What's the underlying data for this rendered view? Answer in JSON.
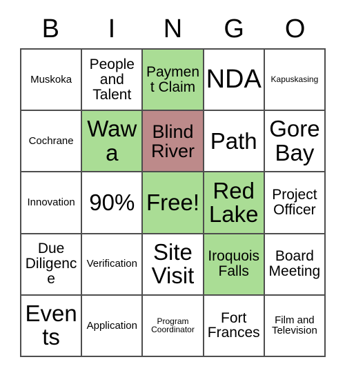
{
  "card": {
    "headers": [
      "B",
      "I",
      "N",
      "G",
      "O"
    ],
    "free_space_label": "Free!",
    "marked_color_green": "#aadd95",
    "marked_color_rose": "#bd8a8a",
    "grid_line_color": "#4d4d4d",
    "text_color": "#000000",
    "background_color": "#ffffff",
    "rows": [
      [
        {
          "label": "Muskoka",
          "size": "sm",
          "state": "unmarked"
        },
        {
          "label": "People and Talent",
          "size": "md",
          "state": "unmarked"
        },
        {
          "label": "Payment Claim",
          "size": "md",
          "state": "green"
        },
        {
          "label": "NDA",
          "size": "xxl",
          "state": "unmarked"
        },
        {
          "label": "Kapuskasing",
          "size": "xs",
          "state": "unmarked"
        }
      ],
      [
        {
          "label": "Cochrane",
          "size": "sm",
          "state": "unmarked"
        },
        {
          "label": "Wawa",
          "size": "xl",
          "state": "green"
        },
        {
          "label": "Blind River",
          "size": "lg",
          "state": "rose"
        },
        {
          "label": "Path",
          "size": "xl",
          "state": "unmarked"
        },
        {
          "label": "Gore Bay",
          "size": "xl",
          "state": "unmarked"
        }
      ],
      [
        {
          "label": "Innovation",
          "size": "sm",
          "state": "unmarked"
        },
        {
          "label": "90%",
          "size": "xl",
          "state": "unmarked"
        },
        {
          "label": "Free!",
          "size": "xl",
          "state": "green"
        },
        {
          "label": "Red Lake",
          "size": "xl",
          "state": "green"
        },
        {
          "label": "Project Officer",
          "size": "md",
          "state": "unmarked"
        }
      ],
      [
        {
          "label": "Due Diligence",
          "size": "md",
          "state": "unmarked"
        },
        {
          "label": "Verification",
          "size": "sm",
          "state": "unmarked"
        },
        {
          "label": "Site Visit",
          "size": "xl",
          "state": "unmarked"
        },
        {
          "label": "Iroquois Falls",
          "size": "md",
          "state": "green"
        },
        {
          "label": "Board Meeting",
          "size": "md",
          "state": "unmarked"
        }
      ],
      [
        {
          "label": "Events",
          "size": "xl",
          "state": "unmarked"
        },
        {
          "label": "Application",
          "size": "sm",
          "state": "unmarked"
        },
        {
          "label": "Program Coordinator",
          "size": "xs",
          "state": "unmarked"
        },
        {
          "label": "Fort Frances",
          "size": "md",
          "state": "unmarked"
        },
        {
          "label": "Film and Television",
          "size": "sm",
          "state": "unmarked"
        }
      ]
    ]
  }
}
